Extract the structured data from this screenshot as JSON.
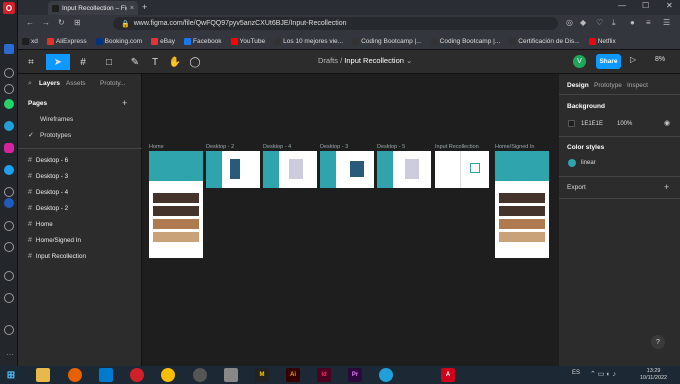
{
  "browser": {
    "tab_title": "Input Recollection – Figma",
    "url": "www.figma.com/file/QwFQQ97pyv5anzCXUt6BJE/Input-Recollection",
    "bookmarks": [
      {
        "label": "xd",
        "color": "#1e1e1e"
      },
      {
        "label": "AliExpress",
        "color": "#e43225"
      },
      {
        "label": "Booking.com",
        "color": "#003580"
      },
      {
        "label": "eBay",
        "color": "#e53238"
      },
      {
        "label": "Facebook",
        "color": "#1877f2"
      },
      {
        "label": "YouTube",
        "color": "#ff0000"
      },
      {
        "label": "Los 10 mejores vie...",
        "color": "#333"
      },
      {
        "label": "Coding Bootcamp |...",
        "color": "#333"
      },
      {
        "label": "Coding Bootcamp |...",
        "color": "#333"
      },
      {
        "label": "Certificación de Dis...",
        "color": "#333"
      },
      {
        "label": "Netflix",
        "color": "#e50914"
      }
    ]
  },
  "figma": {
    "breadcrumb_root": "Drafts",
    "breadcrumb_sep": "/",
    "file_name": "Input Recollection",
    "avatar_initial": "V",
    "share_label": "Share",
    "zoom": "8%",
    "left_tabs": [
      "Layers",
      "Assets",
      "Prototy..."
    ],
    "pages_title": "Pages",
    "pages": [
      {
        "label": "Wireframes",
        "selected": false
      },
      {
        "label": "Prototypes",
        "selected": true
      }
    ],
    "layers": [
      "Desktop - 6",
      "Desktop - 3",
      "Desktop - 4",
      "Desktop - 2",
      "Home",
      "Home/Signed In",
      "Input Recollection"
    ],
    "right_tabs": [
      "Design",
      "Prototype",
      "Inspect"
    ],
    "background_title": "Background",
    "background_hex": "1E1E1E",
    "background_opacity": "100%",
    "color_styles_title": "Color styles",
    "color_style_name": "linear",
    "color_style_color": "#2fa4ad",
    "export_title": "Export",
    "frames": [
      "Home",
      "Desktop - 2",
      "Desktop - 4",
      "Desktop - 3",
      "Desktop - 5",
      "Input Recollection",
      "Home/Signed In"
    ]
  },
  "taskbar": {
    "lang": "ES",
    "time": "13:29",
    "date": "10/11/2022"
  }
}
